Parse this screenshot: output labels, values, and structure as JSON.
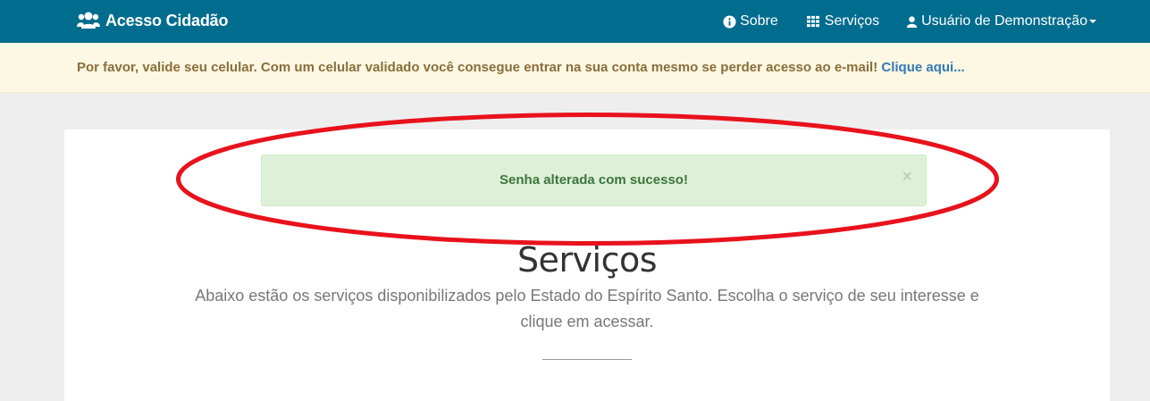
{
  "navbar": {
    "brand": "Acesso Cidadão",
    "items": [
      {
        "label": "Sobre",
        "icon": "info-circle-icon"
      },
      {
        "label": "Serviços",
        "icon": "grid-icon"
      },
      {
        "label": "Usuário de Demonstração",
        "icon": "user-icon"
      }
    ],
    "color": "#006c8e"
  },
  "warning": {
    "message": "Por favor, valide seu celular. Com um celular validado você consegue entrar na sua conta mesmo se perder acesso ao e-mail!",
    "link_label": "Clique aqui..."
  },
  "alert": {
    "message": "Senha alterada com sucesso!",
    "close_symbol": "×"
  },
  "section": {
    "title": "Serviços",
    "description": "Abaixo estão os serviços disponibilizados pelo Estado do Espírito Santo. Escolha o serviço de seu interesse e clique em acessar."
  },
  "annotation": {
    "shape": "ellipse",
    "color": "#e8121c"
  }
}
